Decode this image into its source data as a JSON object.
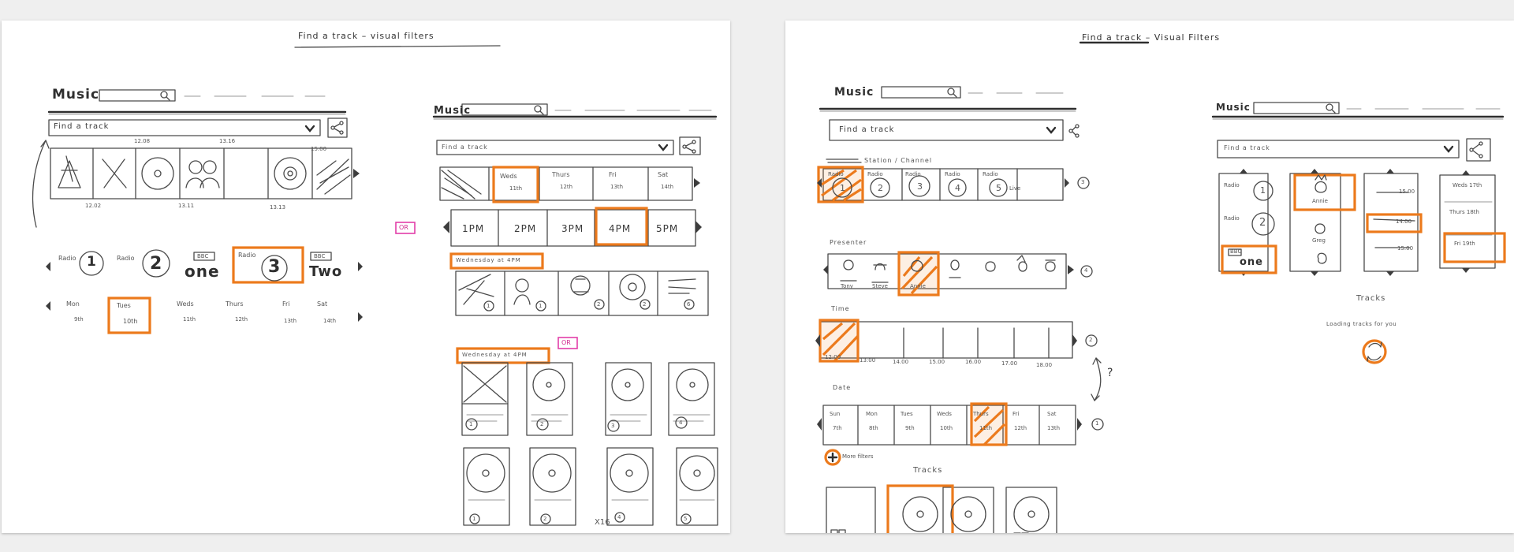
{
  "left_sheet": {
    "title": "Find a track – visual filters",
    "wire_a": {
      "logo": "Music",
      "dropdown": "Find a track",
      "times_top": [
        "12.08",
        "13.16",
        "15.00"
      ],
      "times_bottom": [
        "12.02",
        "13.11",
        "13.13"
      ],
      "stations": [
        {
          "label": "Radio",
          "number": "1"
        },
        {
          "label": "Radio",
          "number": "2"
        },
        {
          "label": "BBC",
          "number": "one"
        },
        {
          "label": "Radio",
          "number": "3"
        },
        {
          "label": "BBC",
          "number": "Two"
        }
      ],
      "days": [
        {
          "day": "Mon",
          "date": "9th"
        },
        {
          "day": "Tues",
          "date": "10th"
        },
        {
          "day": "Weds",
          "date": "11th"
        },
        {
          "day": "Thurs",
          "date": "12th"
        },
        {
          "day": "Fri",
          "date": "13th"
        },
        {
          "day": "Sat",
          "date": "14th"
        }
      ]
    },
    "or_labels": [
      "OR",
      "OR"
    ],
    "wire_b": {
      "logo": "Music",
      "dropdown": "Find a track",
      "days": [
        {
          "day": "Weds",
          "date": "11th"
        },
        {
          "day": "Thurs",
          "date": "12th"
        },
        {
          "day": "Fri",
          "date": "13th"
        },
        {
          "day": "Sat",
          "date": "14th"
        }
      ],
      "times": [
        "1PM",
        "2PM",
        "3PM",
        "4PM",
        "5PM"
      ],
      "heading_1": "Wednesday at 4PM",
      "heading_2": "Wednesday at 4PM",
      "grid_numbers": [
        "1",
        "2",
        "3",
        "4",
        "1",
        "2",
        "4",
        "5"
      ],
      "row_numbers": [
        "1",
        "1",
        "2",
        "2",
        "6"
      ],
      "footer": "X16"
    }
  },
  "right_sheet": {
    "title": "Find a track – Visual Filters",
    "wire_c": {
      "logo": "Music",
      "dropdown": "Find a track",
      "section_station": "Station / Channel",
      "stations": [
        {
          "label": "Radio",
          "number": "1"
        },
        {
          "label": "Radio",
          "number": "2"
        },
        {
          "label": "Radio",
          "number": "3"
        },
        {
          "label": "Radio",
          "number": "4"
        },
        {
          "label": "Radio",
          "number": "5"
        }
      ],
      "station_extra": "Live",
      "section_presenter": "Presenter",
      "presenters": [
        "Tony",
        "Steve",
        "Annie",
        "",
        "",
        "",
        ""
      ],
      "section_time": "Time",
      "times": [
        "12:00",
        "13:00",
        "14.00",
        "15.00",
        "16.00",
        "17.00",
        "18.00"
      ],
      "section_date": "Date",
      "dates": [
        {
          "day": "Sun",
          "date": "7th"
        },
        {
          "day": "Mon",
          "date": "8th"
        },
        {
          "day": "Tues",
          "date": "9th"
        },
        {
          "day": "Weds",
          "date": "10th"
        },
        {
          "day": "Thurs",
          "date": "11th"
        },
        {
          "day": "Fri",
          "date": "12th"
        },
        {
          "day": "Sat",
          "date": "13th"
        }
      ],
      "side_numbers": [
        "3",
        "4",
        "2",
        "1"
      ],
      "question_mark": "?",
      "more_filters": "More filters",
      "tracks_heading": "Tracks"
    },
    "wire_d": {
      "logo": "Music",
      "dropdown": "Find a track",
      "stations": [
        {
          "label": "Radio",
          "number": "1"
        },
        {
          "label": "Radio",
          "number": "2"
        },
        {
          "label": "BBC",
          "number": "one"
        }
      ],
      "presenters": [
        "Annie",
        "Greg"
      ],
      "times": [
        "15.00",
        "14.00",
        "15.00"
      ],
      "dates": [
        "Weds 17th",
        "Thurs 18th",
        "Fri 19th"
      ],
      "tracks_heading": "Tracks",
      "loading_text": "Loading tracks for you"
    }
  }
}
